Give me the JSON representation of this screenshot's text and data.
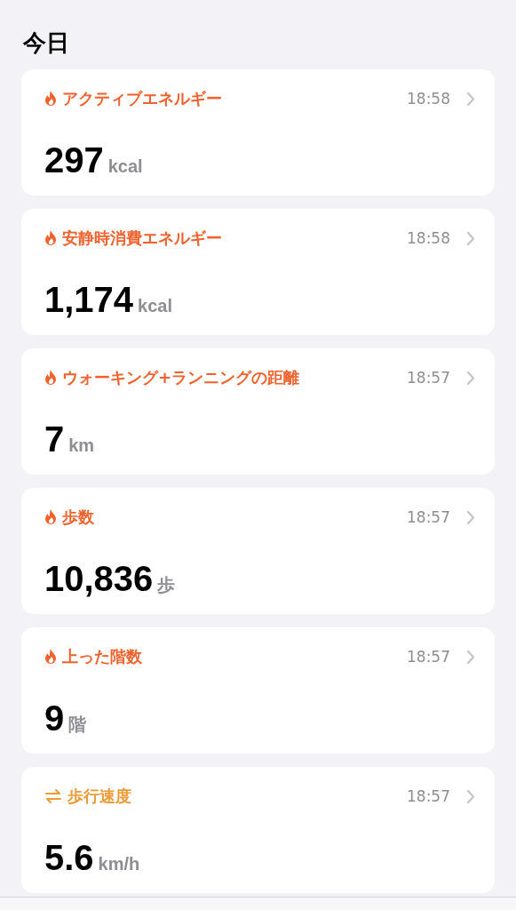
{
  "header": {
    "title": "今日"
  },
  "cards": [
    {
      "kind": "flame",
      "color": "#f0622d",
      "title": "アクティブエネルギー",
      "time": "18:58",
      "value": "297",
      "unit": "kcal"
    },
    {
      "kind": "flame",
      "color": "#f0622d",
      "title": "安静時消費エネルギー",
      "time": "18:58",
      "value": "1,174",
      "unit": "kcal"
    },
    {
      "kind": "flame",
      "color": "#f0622d",
      "title": "ウォーキング+ランニングの距離",
      "time": "18:57",
      "value": "7",
      "unit": "km"
    },
    {
      "kind": "flame",
      "color": "#f0622d",
      "title": "歩数",
      "time": "18:57",
      "value": "10,836",
      "unit": "歩"
    },
    {
      "kind": "flame",
      "color": "#f0622d",
      "title": "上った階数",
      "time": "18:57",
      "value": "9",
      "unit": "階"
    },
    {
      "kind": "arrows",
      "color": "#ee9a35",
      "title": "歩行速度",
      "time": "18:57",
      "value": "5.6",
      "unit": "km/h"
    }
  ]
}
